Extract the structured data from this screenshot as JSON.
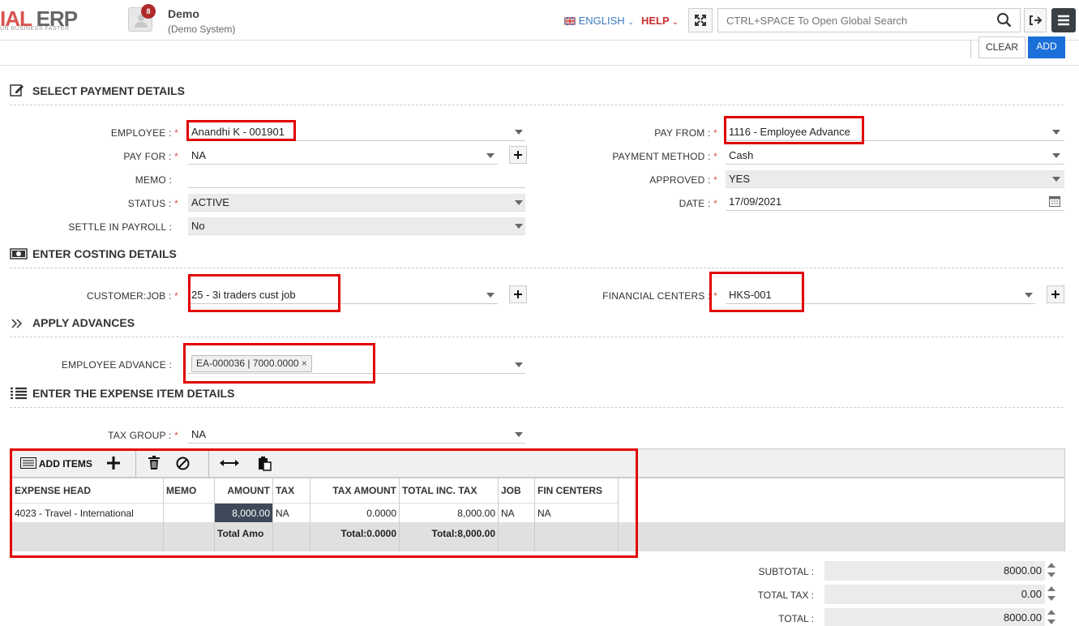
{
  "header": {
    "logo_text_a": "IAL",
    "logo_text_b": " ERP",
    "logo_tagline": "UN BUSINESS FASTER",
    "notification_count": "8",
    "company_name": "Demo",
    "company_sub": "(Demo System)",
    "language": "ENGLISH",
    "help": "HELP",
    "search_placeholder": "CTRL+SPACE To Open Global Search"
  },
  "actions": {
    "clear": "CLEAR",
    "add": "ADD"
  },
  "sections": {
    "payment": "SELECT PAYMENT DETAILS",
    "costing": "ENTER COSTING DETAILS",
    "advances": "APPLY ADVANCES",
    "expense": "ENTER THE EXPENSE ITEM DETAILS"
  },
  "payment": {
    "employee_label": "EMPLOYEE :",
    "employee_value": "Anandhi  K - 001901",
    "pay_for_label": "PAY FOR :",
    "pay_for_value": "NA",
    "memo_label": "MEMO :",
    "memo_value": "",
    "status_label": "STATUS :",
    "status_value": "ACTIVE",
    "settle_label": "SETTLE IN PAYROLL :",
    "settle_value": "No",
    "pay_from_label": "PAY FROM :",
    "pay_from_value": "1116 - Employee Advance",
    "method_label": "PAYMENT METHOD :",
    "method_value": "Cash",
    "approved_label": "APPROVED :",
    "approved_value": "YES",
    "date_label": "DATE :",
    "date_value": "17/09/2021"
  },
  "costing": {
    "customer_label": "CUSTOMER:JOB :",
    "customer_value": "25 - 3i traders cust job",
    "fin_label": "FINANCIAL CENTERS :",
    "fin_value": "HKS-001"
  },
  "advances": {
    "label": "EMPLOYEE ADVANCE :",
    "tag": "EA-000036 | 7000.0000"
  },
  "expense": {
    "tax_group_label": "TAX GROUP :",
    "tax_group_value": "NA",
    "toolbar_add_items": "ADD ITEMS",
    "columns": [
      "EXPENSE HEAD",
      "MEMO",
      "AMOUNT",
      "TAX",
      "TAX AMOUNT",
      "TOTAL INC. TAX",
      "JOB",
      "FIN CENTERS"
    ],
    "row": [
      "4023 - Travel - International",
      "",
      "8,000.00",
      "NA",
      "0.0000",
      "8,000.00",
      "NA",
      "NA"
    ],
    "footer": [
      "",
      "",
      "Total Amo",
      "",
      "Total:0.0000",
      "Total:8,000.00",
      "",
      ""
    ]
  },
  "totals": {
    "subtotal_label": "SUBTOTAL :",
    "subtotal_value": "8000.00",
    "tax_label": "TOTAL TAX :",
    "tax_value": "0.00",
    "total_label": "TOTAL :",
    "total_value": "8000.00"
  },
  "colors": {
    "accent": "#1a6fd9",
    "required": "#d9534f",
    "highlight_box": "#e00000"
  }
}
